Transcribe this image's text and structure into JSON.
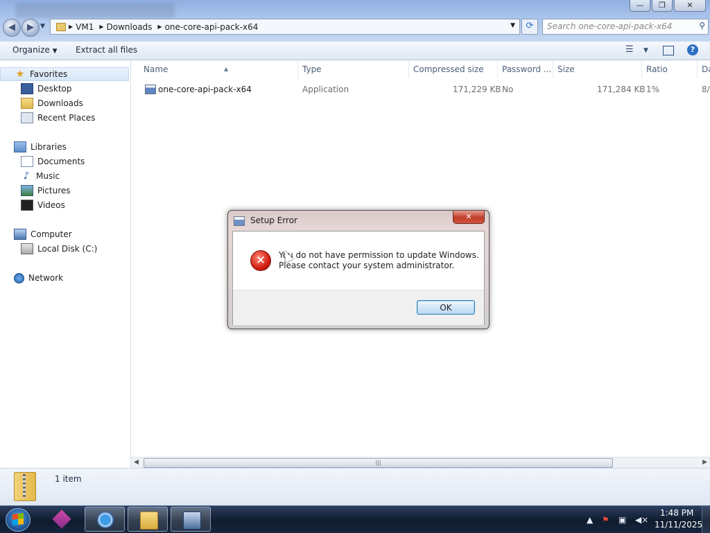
{
  "window": {
    "controls": [
      "—",
      "❐",
      "✕"
    ]
  },
  "address_bar": {
    "crumbs": [
      "VM1",
      "Downloads",
      "one-core-api-pack-x64"
    ],
    "search_placeholder": "Search one-core-api-pack-x64"
  },
  "toolbar": {
    "organize_label": "Organize",
    "extract_label": "Extract all files"
  },
  "nav": {
    "favorites": "Favorites",
    "desktop": "Desktop",
    "downloads": "Downloads",
    "recent_places": "Recent Places",
    "libraries": "Libraries",
    "documents": "Documents",
    "music": "Music",
    "pictures": "Pictures",
    "videos": "Videos",
    "computer": "Computer",
    "local_disk": "Local Disk (C:)",
    "network": "Network"
  },
  "columns": {
    "name": "Name",
    "type": "Type",
    "compressed_size": "Compressed size",
    "password": "Password ...",
    "size": "Size",
    "ratio": "Ratio",
    "date": "Da"
  },
  "files": [
    {
      "name": "one-core-api-pack-x64",
      "type": "Application",
      "compressed_size": "171,229 KB",
      "password": "No",
      "size": "171,284 KB",
      "ratio": "1%",
      "date": "8/"
    }
  ],
  "details": {
    "item_count": "1 item"
  },
  "dialog": {
    "title": "Setup Error",
    "message_line1": "You do not have permission to update Windows.",
    "message_line2": "Please contact your system administrator.",
    "ok_label": "OK"
  },
  "taskbar": {
    "time": "1:48 PM",
    "date": "11/11/2025"
  },
  "colors": {
    "error_red": "#d21f12",
    "accent_blue": "#2f6fc4"
  }
}
